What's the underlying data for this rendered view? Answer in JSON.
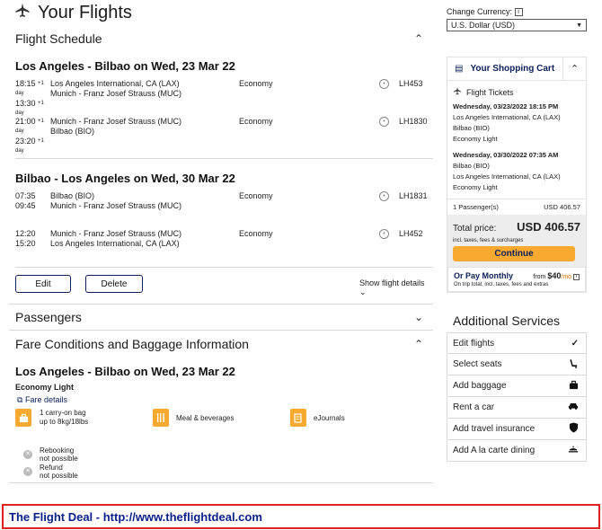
{
  "page": {
    "title": "Your Flights"
  },
  "schedule": {
    "title": "Flight Schedule",
    "routes": [
      {
        "title": "Los Angeles - Bilbao on Wed, 23 Mar 22",
        "segments": [
          {
            "dep": "18:15",
            "dep_extra": "+1 day",
            "arr": "13:30",
            "arr_extra": "+1 day",
            "from": "Los Angeles International, CA (LAX)",
            "to": "Munich - Franz Josef Strauss (MUC)",
            "cabin": "Economy",
            "flight": "LH453"
          },
          {
            "dep": "21:00",
            "dep_extra": "+1 day",
            "arr": "23:20",
            "arr_extra": "+1 day",
            "from": "Munich - Franz Josef Strauss (MUC)",
            "to": "Bilbao (BIO)",
            "cabin": "Economy",
            "flight": "LH1830"
          }
        ]
      },
      {
        "title": "Bilbao - Los Angeles on Wed, 30 Mar 22",
        "segments": [
          {
            "dep": "07:35",
            "dep_extra": "",
            "arr": "09:45",
            "arr_extra": "",
            "from": "Bilbao (BIO)",
            "to": "Munich - Franz Josef Strauss (MUC)",
            "cabin": "Economy",
            "flight": "LH1831"
          },
          {
            "dep": "12:20",
            "dep_extra": "",
            "arr": "15:20",
            "arr_extra": "",
            "from": "Munich - Franz Josef Strauss (MUC)",
            "to": "Los Angeles International, CA (LAX)",
            "cabin": "Economy",
            "flight": "LH452"
          }
        ]
      }
    ],
    "edit_label": "Edit",
    "delete_label": "Delete",
    "show_details_label": "Show flight details"
  },
  "passengers": {
    "title": "Passengers"
  },
  "fare": {
    "title": "Fare Conditions and Baggage Information",
    "route_title": "Los Angeles - Bilbao on Wed, 23 Mar 22",
    "fare_name": "Economy Light",
    "fare_details_link": "Fare details",
    "baggage_line1": "1 carry-on bag",
    "baggage_line2": "up to 8kg/18lbs",
    "meal": "Meal & beverages",
    "ejournals": "eJournals",
    "rebooking_line1": "Rebooking",
    "rebooking_line2": "not possible",
    "refund_line1": "Refund",
    "refund_line2": "not possible"
  },
  "currency": {
    "label": "Change Currency:",
    "info": "i",
    "selected": "U.S. Dollar (USD)"
  },
  "cart": {
    "title": "Your Shopping Cart",
    "tickets_title": "Flight Tickets",
    "outbound_date": "Wednesday, 03/23/2022 18:15 PM",
    "outbound_from": "Los Angeles International, CA (LAX)",
    "outbound_to": "Bilbao (BIO)",
    "outbound_fare": "Economy Light",
    "return_date": "Wednesday, 03/30/2022 07:35 AM",
    "return_from": "Bilbao (BIO)",
    "return_to": "Los Angeles International, CA (LAX)",
    "return_fare": "Economy Light",
    "passengers_label": "1 Passenger(s)",
    "passengers_price": "USD 406.57",
    "total_label": "Total price:",
    "total_value": "USD 406.57",
    "taxes_note": "incl. taxes, fees & surcharges",
    "continue_label": "Continue",
    "monthly_title": "Or Pay Monthly",
    "monthly_from": "from",
    "monthly_amount": "$40",
    "monthly_unit": "/mo",
    "monthly_note": "On trip total, incl. taxes, fees and extras"
  },
  "services": {
    "title": "Additional Services",
    "items": [
      {
        "label": "Edit flights",
        "icon": "check-icon"
      },
      {
        "label": "Select seats",
        "icon": "seat-icon"
      },
      {
        "label": "Add baggage",
        "icon": "baggage-icon"
      },
      {
        "label": "Rent a car",
        "icon": "car-icon"
      },
      {
        "label": "Add travel insurance",
        "icon": "shield-icon"
      },
      {
        "label": "Add A la carte dining",
        "icon": "dining-icon"
      }
    ]
  },
  "footer": {
    "text": "The Flight Deal - http://www.theflightdeal.com"
  },
  "colors": {
    "accent_orange": "#f8a930",
    "brand_navy": "#0b1f5a",
    "footer_red": "#e02020",
    "footer_text": "#0b1f8a"
  }
}
